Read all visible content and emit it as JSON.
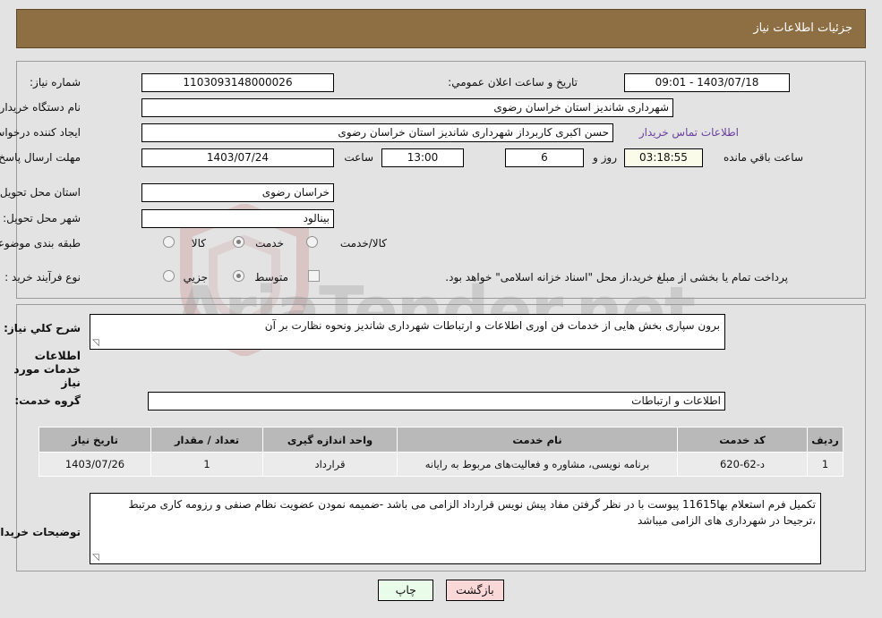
{
  "header": {
    "title": "جزئیات اطلاعات نیاز"
  },
  "watermark": {
    "text": "AriaTender.net",
    "logo": "shield-logo"
  },
  "form": {
    "need_number": {
      "label": "شماره نیاز:",
      "value": "1103093148000026"
    },
    "public_announce": {
      "label": "تاریخ و ساعت اعلان عمومي:",
      "value": "1403/07/18 - 09:01"
    },
    "buyer_org": {
      "label": "نام دستگاه خریدار:",
      "value": "شهرداری شاندیز استان خراسان رضوی"
    },
    "requester": {
      "label": "ایجاد کننده درخواست:",
      "value": "حسن اکبری کاربرداز شهرداری شاندیز استان خراسان رضوی"
    },
    "buyer_contact_link": "اطلاعات تماس خریدار",
    "deadline": {
      "label": "مهلت ارسال پاسخ: تا تاریخ:",
      "date": "1403/07/24",
      "time_label": "ساعت",
      "time": "13:00",
      "days": "6",
      "days_label": "روز و",
      "countdown": "03:18:55",
      "countdown_label": "ساعت باقي مانده"
    },
    "delivery_province": {
      "label": "استان محل تحویل:",
      "value": "خراسان رضوی"
    },
    "delivery_city": {
      "label": "شهر محل تحویل:",
      "value": "بینالود"
    },
    "subject_class": {
      "label": "طبقه بندی موضوعی:",
      "options": [
        "کالا",
        "خدمت",
        "کالا/خدمت"
      ],
      "selected": "خدمت"
    },
    "purchase_type": {
      "label": "نوع فرآیند خرید :",
      "options": [
        "جزیي",
        "متوسط"
      ],
      "selected": "متوسط",
      "checkbox_text": "پرداخت تمام یا بخشی از مبلغ خرید،از محل \"اسناد خزانه اسلامی\" خواهد بود.",
      "checkbox_checked": false
    }
  },
  "middle": {
    "general_desc": {
      "label": "شرح کلي نیاز:",
      "value": "برون سپاری بخش هایی از خدمات فن اوری اطلاعات و ارتباطات شهرداری شاندیز ونحوه نظارت بر آن"
    },
    "services_section_title": "اطلاعات خدمات مورد نیاز",
    "service_group": {
      "label": "گروه خدمت:",
      "value": "اطلاعات و ارتباطات"
    },
    "buyer_notes": {
      "label": "توضیحات خریدار:",
      "value": "تکمیل فرم استعلام بها11615 پیوست با در نظر گرفتن مفاد پیش نویس قرارداد الزامی می باشد -ضمیمه نمودن عضویت نظام صنفی و رزومه کاری مرتبط ،ترجیحا در شهرداری های الزامی میباشد"
    }
  },
  "table": {
    "columns": [
      "ردیف",
      "کد خدمت",
      "نام خدمت",
      "واحد اندازه گیری",
      "تعداد / مقدار",
      "تاریخ نیاز"
    ],
    "rows": [
      {
        "row": "1",
        "code": "د-62-620",
        "name": "برنامه نویسی، مشاوره و فعالیت‌های مربوط به رایانه",
        "unit": "قرارداد",
        "qty": "1",
        "date": "1403/07/26"
      }
    ]
  },
  "footer": {
    "print_label": "چاپ",
    "back_label": "بازگشت"
  },
  "colors": {
    "header_bg": "#8d6f43",
    "page_bg": "#e3e3e3",
    "table_header_bg": "#b9b9b9",
    "table_row_bg": "#ebebeb",
    "link": "#6a3fa0",
    "print_btn": "#e9fbe9",
    "back_btn": "#fbd8d8",
    "timer_bg": "#fbfbea"
  }
}
